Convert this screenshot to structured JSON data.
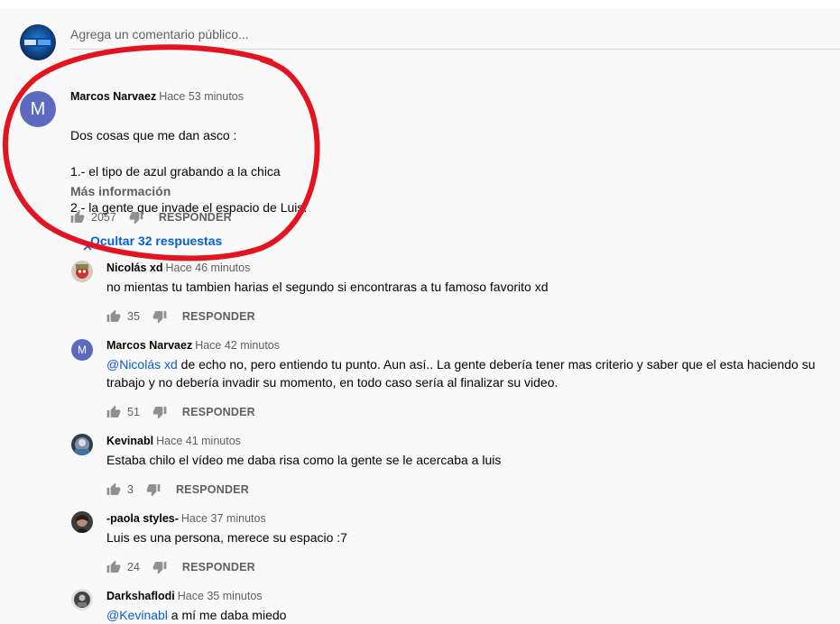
{
  "comment_input": {
    "placeholder": "Agrega un comentario público..."
  },
  "top_comment": {
    "author": "Marcos Narvaez",
    "time": "Hace 53 minutos",
    "avatar_letter": "M",
    "lines": [
      "Dos cosas que me dan asco :",
      "1.- el tipo de azul grabando a la chica",
      "2.- la gente que invade el espacio de Luis."
    ],
    "more_label": "Más información",
    "likes": "2057",
    "reply_label": "RESPONDER",
    "hide_replies_label": "Ocultar 32 respuestas"
  },
  "replies": [
    {
      "author": "Nicolás xd",
      "time": "Hace 46 minutos",
      "mention": "",
      "text": "no mientas tu tambien harias el segundo si encontraras a tu famoso favorito xd",
      "likes": "35",
      "reply_label": "RESPONDER"
    },
    {
      "author": "Marcos Narvaez",
      "time": "Hace 42 minutos",
      "avatar_letter": "M",
      "mention": "@Nicolás xd",
      "text": " de echo no, pero entiendo tu punto. Aun así.. La gente debería tener mas criterio y saber que el esta haciendo su trabajo y no debería invadir su momento, en todo caso sería al finalizar su video.",
      "likes": "51",
      "reply_label": "RESPONDER"
    },
    {
      "author": "Kevinabl",
      "time": "Hace 41 minutos",
      "mention": "",
      "text": "Estaba chilo el vídeo me daba risa como la gente se le acercaba a luis",
      "likes": "3",
      "reply_label": "RESPONDER"
    },
    {
      "author": "-paola styles-",
      "time": "Hace 37 minutos",
      "mention": "",
      "text": "Luis es una persona, merece su espacio :7",
      "likes": "24",
      "reply_label": "RESPONDER"
    },
    {
      "author": "Darkshaflodi",
      "time": "Hace 35 minutos",
      "mention": "@Kevinabl",
      "text": " a mí me daba miedo",
      "likes": "",
      "reply_label": ""
    }
  ],
  "colors": {
    "annotation_circle": "#e3141f",
    "link": "#065fd4",
    "letter_avatar": "#5c6bc0"
  },
  "icons": [
    "thumbs-up-icon",
    "thumbs-down-icon",
    "chevron-up-icon"
  ]
}
